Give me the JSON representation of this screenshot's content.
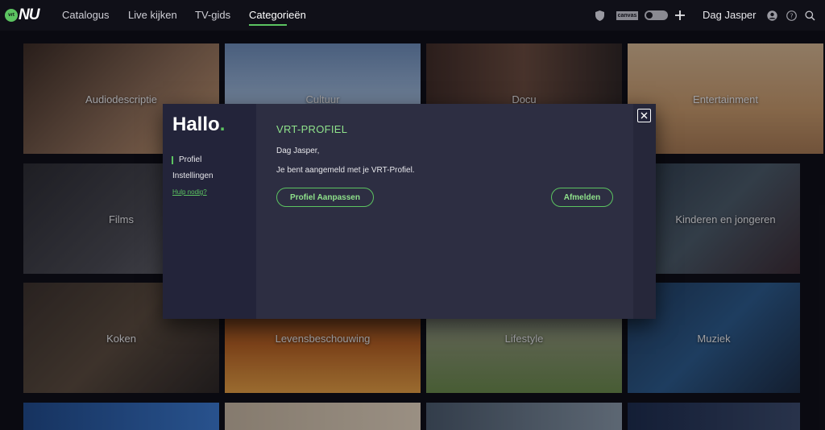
{
  "nav": {
    "logo_text": "NU",
    "logo_badge": "vrt",
    "items": [
      {
        "label": "Catalogus"
      },
      {
        "label": "Live kijken"
      },
      {
        "label": "TV-gids"
      },
      {
        "label": "Categorieën"
      }
    ],
    "active_index": 3,
    "username": "Dag Jasper",
    "icons": [
      "shield-icon",
      "canvas-badge",
      "ketnet-badge",
      "plus-icon",
      "user-icon",
      "help-icon",
      "search-icon"
    ],
    "canvas_label": "canvas",
    "accent": "#5cc461"
  },
  "categories": [
    {
      "label": "Audiodescriptie"
    },
    {
      "label": "Cultuur"
    },
    {
      "label": "Docu"
    },
    {
      "label": "Entertainment"
    },
    {
      "label": "Films"
    },
    {
      "label": ""
    },
    {
      "label": ""
    },
    {
      "label": "Kinderen en jongeren"
    },
    {
      "label": "Koken"
    },
    {
      "label": "Levensbeschouwing"
    },
    {
      "label": "Lifestyle"
    },
    {
      "label": "Muziek"
    }
  ],
  "modal": {
    "greeting": "Hallo",
    "greeting_dot": ".",
    "side_items": [
      {
        "label": "Profiel"
      },
      {
        "label": "Instellingen"
      }
    ],
    "help_link": "Hulp nodig?",
    "title": "VRT-PROFIEL",
    "greeting_line": "Dag Jasper,",
    "message": "Je bent aangemeld met je VRT-Profiel.",
    "edit_button": "Profiel Aanpassen",
    "logout_button": "Afmelden"
  }
}
